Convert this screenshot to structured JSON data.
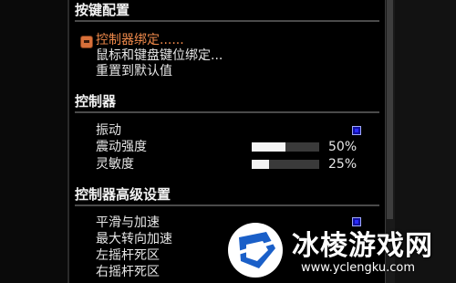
{
  "sections": {
    "keybind": {
      "title": "按键配置",
      "items": [
        "控制器绑定......",
        "鼠标和键盘键位绑定...",
        "重置到默认值"
      ]
    },
    "controller": {
      "title": "控制器",
      "vibration_label": "振动",
      "vibration_on": true,
      "vibration_strength_label": "震动强度",
      "vibration_strength_value": "50%",
      "vibration_strength_fraction": 0.5,
      "sensitivity_label": "灵敏度",
      "sensitivity_value": "25%",
      "sensitivity_fraction": 0.25
    },
    "advanced": {
      "title": "控制器高级设置",
      "items": [
        "平滑与加速",
        "最大转向加速",
        "左摇杆死区",
        "右摇杆死区"
      ],
      "smoothing_on": true
    }
  },
  "watermark": {
    "title": "冰棱游戏网",
    "url": "www.yclengku.com"
  },
  "colors": {
    "selected": "#f08a4b",
    "toggle": "#2a2aff",
    "background": "#000000"
  },
  "icons": [
    "selection-marker-icon",
    "toggle-checkbox-icon",
    "watermark-logo-icon"
  ]
}
